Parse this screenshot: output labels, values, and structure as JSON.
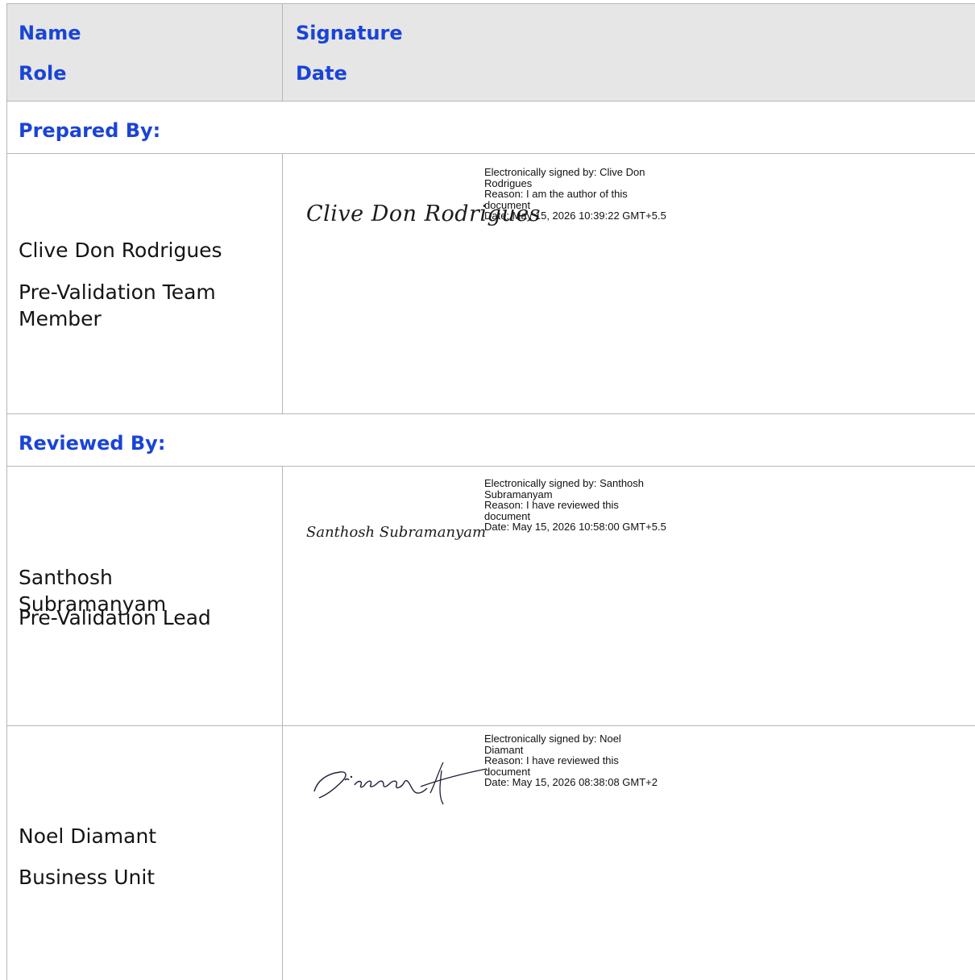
{
  "header": {
    "col1_line1": "Name",
    "col1_line2": "Role",
    "col2_line1": "Signature",
    "col2_line2": "Date"
  },
  "sections": {
    "prepared": {
      "title": "Prepared By:"
    },
    "reviewed": {
      "title": "Reviewed By:"
    }
  },
  "signers": [
    {
      "name": "Clive Don Rodrigues",
      "role": "Pre-Validation Team Member",
      "signature_script": "Clive Don Rodrigues",
      "sig_lines": [
        "Electronically signed by: Clive Don",
        "Rodrigues",
        "Reason: I am the author of this",
        "document",
        "Date: May 15, 2026 10:39:22 GMT+5.5"
      ]
    },
    {
      "name": "Santhosh Subramanyam",
      "role": "Pre-Validation Lead",
      "signature_script": "Santhosh Subramanyam",
      "sig_lines": [
        "Electronically signed by: Santhosh",
        "Subramanyam",
        "Reason:  I have reviewed this",
        "document",
        "Date: May 15, 2026 10:58:00 GMT+5.5"
      ]
    },
    {
      "name": "Noel Diamant",
      "role": "Business Unit",
      "signature_script": "Diamant",
      "sig_lines": [
        "Electronically signed by: Noel",
        "Diamant",
        "Reason:  I have reviewed this",
        "document",
        "Date: May 15, 2026 08:38:08 GMT+2"
      ]
    }
  ],
  "colors": {
    "heading_blue": "#1a44d6",
    "header_bg": "#e6e6e6",
    "grid": "#b7b7b7"
  }
}
